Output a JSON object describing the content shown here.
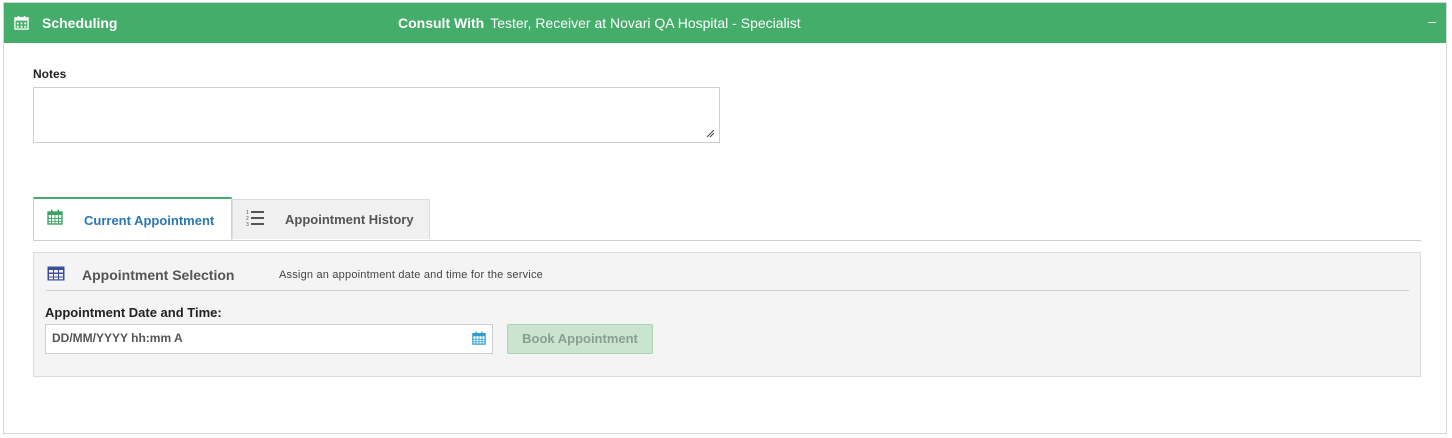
{
  "header": {
    "title": "Scheduling",
    "consult_prefix": "Consult With",
    "consult_name": "Tester, Receiver at Novari QA Hospital - Specialist",
    "collapse_symbol": "–",
    "background_color": "#44ad6a"
  },
  "notes": {
    "label": "Notes",
    "value": ""
  },
  "tabs": [
    {
      "label": "Current Appointment",
      "icon": "calendar-icon",
      "active": true
    },
    {
      "label": "Appointment History",
      "icon": "numbered-list-icon",
      "active": false
    }
  ],
  "appointment_section": {
    "title": "Appointment Selection",
    "subtitle": "Assign an appointment date and time for the service",
    "date_label": "Appointment Date and Time:",
    "date_placeholder": "DD/MM/YYYY hh:mm A",
    "date_value": "",
    "book_button_label": "Book Appointment",
    "book_button_disabled": true
  }
}
